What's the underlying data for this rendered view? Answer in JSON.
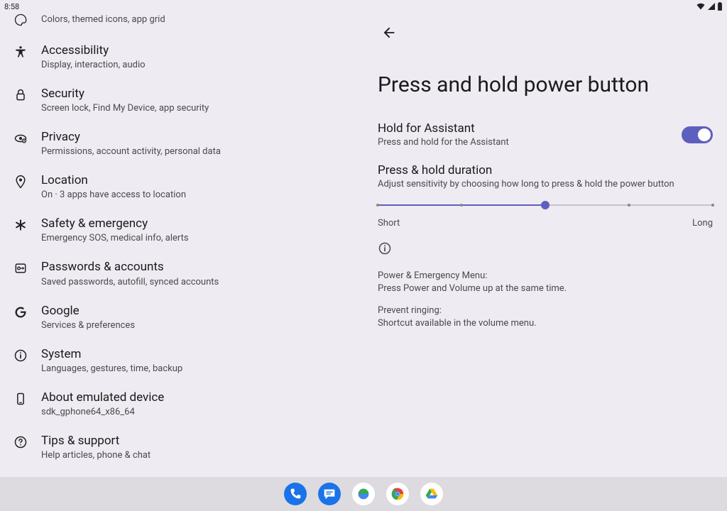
{
  "status": {
    "time": "8:58"
  },
  "left": {
    "partial_sub": "Colors, themed icons, app grid",
    "items": [
      {
        "title": "Accessibility",
        "sub": "Display, interaction, audio",
        "icon": "accessibility"
      },
      {
        "title": "Security",
        "sub": "Screen lock, Find My Device, app security",
        "icon": "lock"
      },
      {
        "title": "Privacy",
        "sub": "Permissions, account activity, personal data",
        "icon": "privacy"
      },
      {
        "title": "Location",
        "sub": "On · 3 apps have access to location",
        "icon": "location"
      },
      {
        "title": "Safety & emergency",
        "sub": "Emergency SOS, medical info, alerts",
        "icon": "asterisk"
      },
      {
        "title": "Passwords & accounts",
        "sub": "Saved passwords, autofill, synced accounts",
        "icon": "key"
      },
      {
        "title": "Google",
        "sub": "Services & preferences",
        "icon": "google"
      },
      {
        "title": "System",
        "sub": "Languages, gestures, time, backup",
        "icon": "info"
      },
      {
        "title": "About emulated device",
        "sub": "sdk_gphone64_x86_64",
        "icon": "device"
      },
      {
        "title": "Tips & support",
        "sub": "Help articles, phone & chat",
        "icon": "help"
      }
    ]
  },
  "right": {
    "title": "Press and hold power button",
    "hold": {
      "title": "Hold for Assistant",
      "sub": "Press and hold for the Assistant",
      "enabled": true
    },
    "duration": {
      "title": "Press & hold duration",
      "sub": "Adjust sensitivity by choosing how long to press & hold the power button",
      "short_label": "Short",
      "long_label": "Long",
      "value_percent": 50,
      "ticks_percent": [
        0,
        25,
        50,
        75,
        100
      ]
    },
    "info": {
      "line1a": "Power & Emergency Menu:",
      "line1b": "Press Power and Volume up at the same time.",
      "line2a": "Prevent ringing:",
      "line2b": "Shortcut available in the volume menu."
    }
  },
  "dock": {
    "apps": [
      {
        "name": "phone",
        "bg": "#1a73e8"
      },
      {
        "name": "messages",
        "bg": "#1a73e8"
      },
      {
        "name": "photos",
        "bg": "#ffffff"
      },
      {
        "name": "chrome",
        "bg": "#ffffff"
      },
      {
        "name": "drive",
        "bg": "#ffffff"
      }
    ]
  }
}
